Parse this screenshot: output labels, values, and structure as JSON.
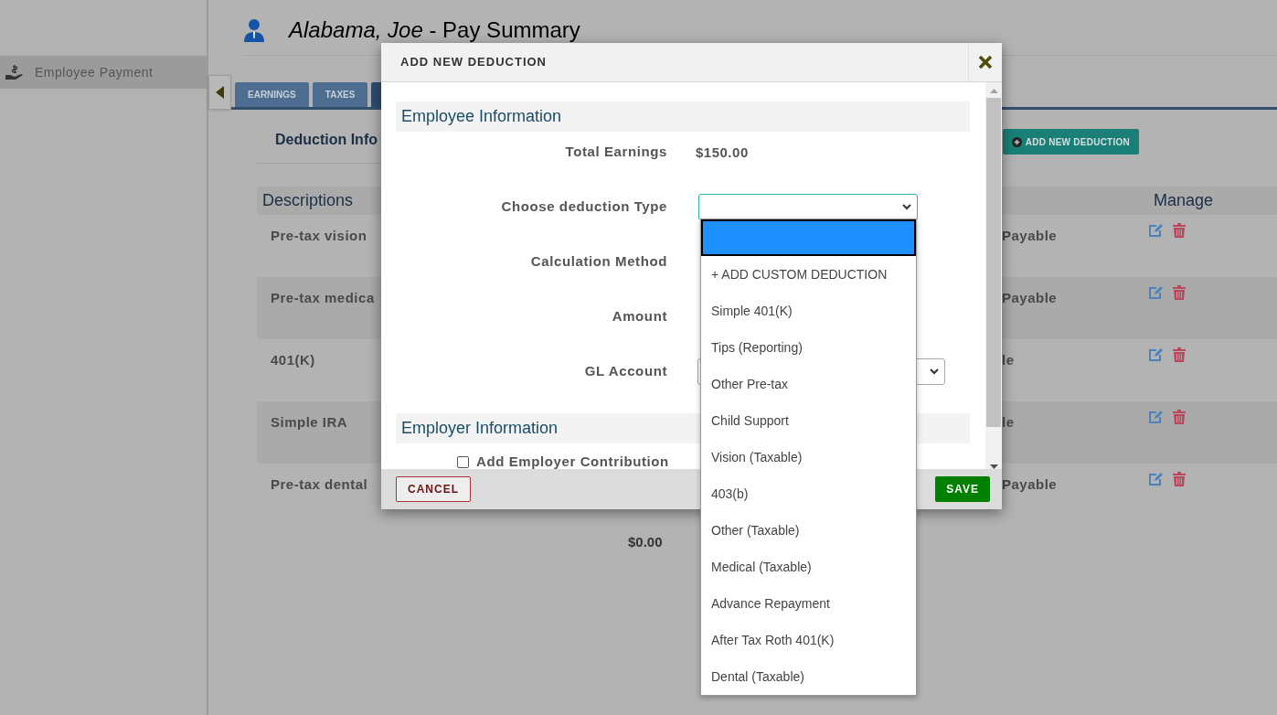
{
  "sidebar": {
    "items": [
      {
        "label": "Employee Payment",
        "selected": true
      }
    ]
  },
  "header": {
    "name": "Alabama, Joe",
    "title": " - Pay Summary"
  },
  "tabs": [
    {
      "label": "EARNINGS",
      "selected": false
    },
    {
      "label": "TAXES",
      "selected": false
    },
    {
      "selected": true
    }
  ],
  "section": {
    "title": "Deduction Info",
    "add_button": "ADD NEW DEDUCTION"
  },
  "table": {
    "columns": [
      "Descriptions",
      "Manage"
    ],
    "rows": [
      {
        "description": "Pre-tax vision",
        "column_2": "Payable"
      },
      {
        "description": "Pre-tax medica",
        "column_2": "Payable"
      },
      {
        "description": "401(K)",
        "column_2": "le"
      },
      {
        "description": "Simple IRA",
        "column_2": "le"
      },
      {
        "description": "Pre-tax dental",
        "column_2": "Payable"
      }
    ],
    "total": "$0.00"
  },
  "dialog": {
    "title": "ADD NEW DEDUCTION",
    "employee_section": "Employee Information",
    "fields": [
      {
        "kind": "text",
        "label": "Total Earnings",
        "value": "$150.00"
      },
      {
        "kind": "select",
        "label": "Choose deduction Type",
        "open": true
      },
      {
        "kind": "none",
        "label": "Calculation Method"
      },
      {
        "kind": "none",
        "label": "Amount"
      },
      {
        "kind": "select",
        "label": "GL Account",
        "open": false
      }
    ],
    "employer_section": "Employer Information",
    "employer_contribution": {
      "label": "Add Employer Contribution",
      "checked": false
    },
    "cancel": "CANCEL",
    "save": "SAVE"
  },
  "dropdown": {
    "options": [
      {
        "selected": true
      },
      {
        "label": "+ ADD CUSTOM DEDUCTION",
        "selected": false
      },
      {
        "label": "Simple 401(K)",
        "selected": false
      },
      {
        "label": "Tips (Reporting)",
        "selected": false
      },
      {
        "label": "Other Pre-tax",
        "selected": false
      },
      {
        "label": "Child Support",
        "selected": false
      },
      {
        "label": "Vision (Taxable)",
        "selected": false
      },
      {
        "label": "403(b)",
        "selected": false
      },
      {
        "label": "Other (Taxable)",
        "selected": false
      },
      {
        "label": "Medical (Taxable)",
        "selected": false
      },
      {
        "label": "Advance Repayment",
        "selected": false
      },
      {
        "label": "After Tax Roth 401(K)",
        "selected": false
      },
      {
        "label": "Dental (Taxable)",
        "selected": false
      }
    ]
  }
}
